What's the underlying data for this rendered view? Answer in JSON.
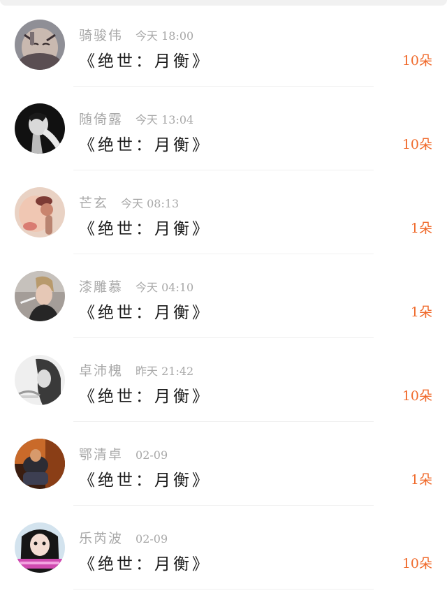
{
  "messages": [
    {
      "name": "骑骏伟",
      "time": "今天 18:00",
      "text": "《绝世：月衡》",
      "count": "10朵",
      "avatar": "avatar-1"
    },
    {
      "name": "随倚露",
      "time": "今天 13:04",
      "text": "《绝世：月衡》",
      "count": "10朵",
      "avatar": "avatar-2"
    },
    {
      "name": "芒玄",
      "time": "今天 08:13",
      "text": "《绝世：月衡》",
      "count": "1朵",
      "avatar": "avatar-3"
    },
    {
      "name": "漆雕慕",
      "time": "今天 04:10",
      "text": "《绝世：月衡》",
      "count": "1朵",
      "avatar": "avatar-4"
    },
    {
      "name": "卓沛槐",
      "time": "昨天 21:42",
      "text": "《绝世：月衡》",
      "count": "10朵",
      "avatar": "avatar-5"
    },
    {
      "name": "鄂清卓",
      "time": "02-09",
      "text": "《绝世：月衡》",
      "count": "1朵",
      "avatar": "avatar-6"
    },
    {
      "name": "乐芮波",
      "time": "02-09",
      "text": "《绝世：月衡》",
      "count": "10朵",
      "avatar": "avatar-7"
    }
  ],
  "colors": {
    "count": "#f06a2b",
    "meta": "#a8a8a8",
    "text": "#1c1c1c",
    "divider": "#f0f0f0"
  }
}
